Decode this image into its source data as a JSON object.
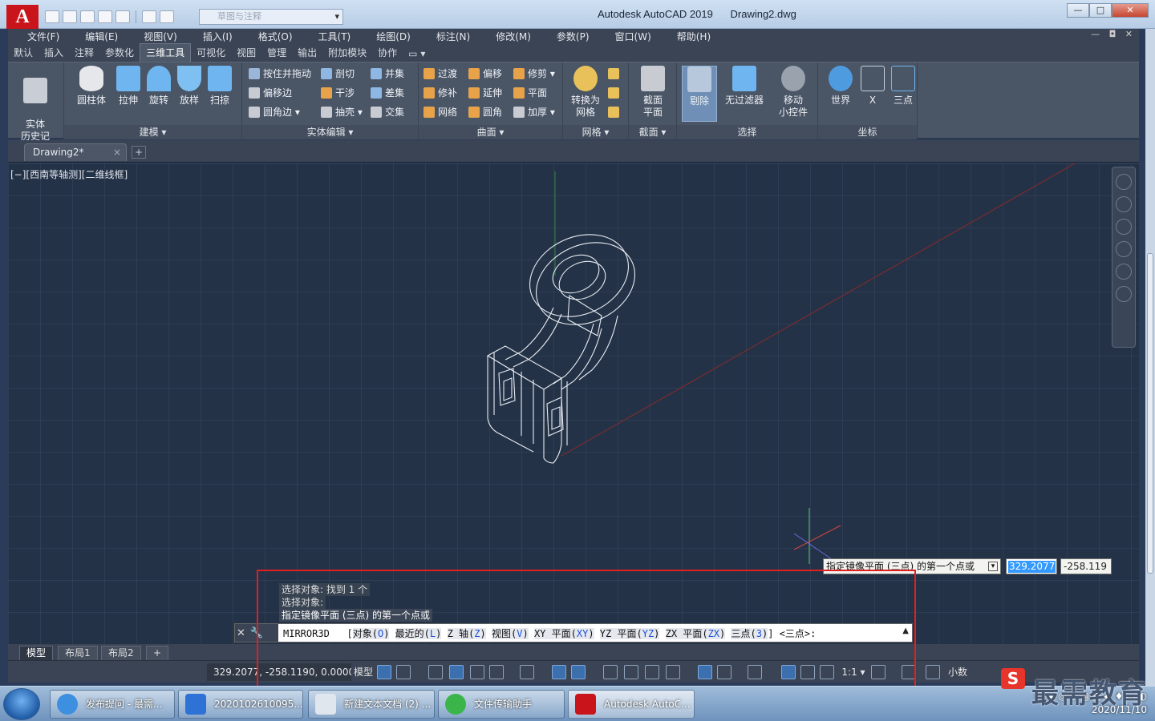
{
  "app": {
    "logo": "A",
    "title": "Autodesk AutoCAD 2019",
    "file": "Drawing2.dwg",
    "workspace_placeholder": "草图与注释",
    "window_buttons": [
      "—",
      "□",
      "✕"
    ]
  },
  "menubar": {
    "items": [
      "文件(F)",
      "编辑(E)",
      "视图(V)",
      "插入(I)",
      "格式(O)",
      "工具(T)",
      "绘图(D)",
      "标注(N)",
      "修改(M)",
      "参数(P)",
      "窗口(W)",
      "帮助(H)"
    ],
    "mdi_buttons": "— ◘ ✕"
  },
  "ribbon_tabs": [
    "默认",
    "插入",
    "注释",
    "参数化",
    "三维工具",
    "可视化",
    "视图",
    "管理",
    "输出",
    "附加模块",
    "协作",
    "▭ ▾"
  ],
  "active_ribbon_tab": "三维工具",
  "ribbon": {
    "history": "实体\n历史记录",
    "modeling": {
      "title": "建模 ▾",
      "buttons": [
        "圆柱体",
        "拉伸",
        "旋转",
        "放样",
        "扫掠"
      ]
    },
    "solid_edit": {
      "title": "实体编辑 ▾",
      "buttons": [
        "按住并拖动",
        "偏移边",
        "圆角边 ▾",
        "剖切",
        "干涉",
        "抽壳 ▾",
        "并集",
        "差集",
        "交集"
      ]
    },
    "surface": {
      "title": "曲面 ▾",
      "buttons": [
        "过渡",
        "修补",
        "网络",
        "偏移",
        "延伸",
        "圆角",
        "修剪 ▾",
        "平面",
        "加厚 ▾"
      ]
    },
    "mesh": {
      "title": "网格 ▾",
      "convert": "转换为\n网格"
    },
    "section": {
      "title": "截面 ▾",
      "plane": "截面\n平面"
    },
    "selection": {
      "title": "选择",
      "culling": "剔除",
      "no_filter": "无过滤器",
      "gizmo": "移动\n小控件"
    },
    "coordinates": {
      "title": "坐标",
      "buttons": [
        "世界",
        "X",
        "三点"
      ]
    }
  },
  "document_tabs": [
    {
      "label": "Drawing2*",
      "close": "×"
    }
  ],
  "doc_plus": "+",
  "viewport": {
    "label": "[−][西南等轴测][二维线框]"
  },
  "dynamic_input": {
    "prompt": "指定镜像平面 (三点) 的第一个点或",
    "x_value": "329.2077",
    "y_value": "-258.119"
  },
  "command_history": [
    "选择对象: 找到 1 个",
    "选择对象:",
    "指定镜像平面 (三点) 的第一个点或"
  ],
  "command_line": {
    "command": "MIRROR3D",
    "options": [
      {
        "bracket": "[",
        "text": "对象",
        "key": "O"
      },
      {
        "text": "最近的",
        "key": "L"
      },
      {
        "text": "Z 轴",
        "key": "Z"
      },
      {
        "text": "视图",
        "key": "V"
      },
      {
        "text": "XY 平面",
        "key": "XY"
      },
      {
        "text": "YZ 平面",
        "key": "YZ"
      },
      {
        "text": "ZX 平面",
        "key": "ZX"
      },
      {
        "text": "三点",
        "key": "3"
      }
    ],
    "default": "<三点>:"
  },
  "layout_tabs": [
    "模型",
    "布局1",
    "布局2",
    "+"
  ],
  "statusbar": {
    "coords": "329.2077, -258.1190, 0.0000",
    "model": "模型",
    "scale": "1:1 ▾",
    "units": "小数"
  },
  "taskbar": {
    "items": [
      "发布提问 - 最需...",
      "2020102610095...",
      "新建文本文档 (2) ...",
      "文件传输助手",
      "Autodesk AutoC..."
    ],
    "date": "2020/11/10"
  },
  "watermark": {
    "logo": "S",
    "text": "最需教育"
  }
}
